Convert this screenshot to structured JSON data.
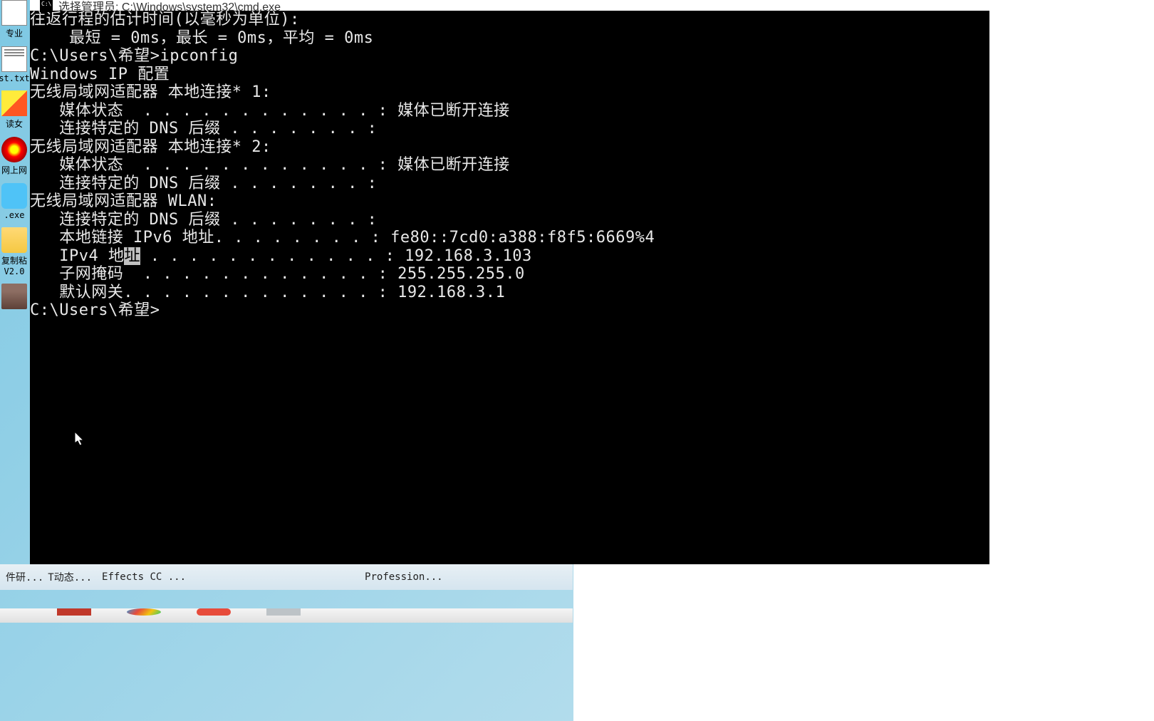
{
  "window": {
    "title": "选择管理员: C:\\Windows\\system32\\cmd.exe"
  },
  "desktop_icons": [
    {
      "label": "专业"
    },
    {
      "label": "st.txt"
    },
    {
      "label": "读女"
    },
    {
      "label": "网上网"
    },
    {
      "label": ".exe"
    },
    {
      "label": "复制粘"
    },
    {
      "label": "V2.0"
    },
    {
      "label": ""
    }
  ],
  "terminal": {
    "line1": "往返行程的估计时间(以毫秒为单位):",
    "line2": "    最短 = 0ms，最长 = 0ms，平均 = 0ms",
    "line3": "",
    "prompt1": "C:\\Users\\希望>",
    "cmd1": "ipconfig",
    "line5": "",
    "line6": "Windows IP 配置",
    "line7": "",
    "line8": "",
    "adapter1_title": "无线局域网适配器 本地连接* 1:",
    "line10": "",
    "adapter1_media": "   媒体状态  . . . . . . . . . . . . : 媒体已断开连接",
    "adapter1_dns": "   连接特定的 DNS 后缀 . . . . . . . :",
    "line13": "",
    "adapter2_title": "无线局域网适配器 本地连接* 2:",
    "line15": "",
    "adapter2_media": "   媒体状态  . . . . . . . . . . . . : 媒体已断开连接",
    "adapter2_dns": "   连接特定的 DNS 后缀 . . . . . . . :",
    "line18": "",
    "adapter3_title": "无线局域网适配器 WLAN:",
    "line20": "",
    "adapter3_dns": "   连接特定的 DNS 后缀 . . . . . . . :",
    "adapter3_ipv6": "   本地链接 IPv6 地址. . . . . . . . : fe80::7cd0:a388:f8f5:6669%4",
    "adapter3_ipv4_label": "   IPv4 地",
    "adapter3_ipv4_hl": "址",
    "adapter3_ipv4_rest": " . . . . . . . . . . . . : 192.168.3.103",
    "adapter3_mask": "   子网掩码  . . . . . . . . . . . . : 255.255.255.0",
    "adapter3_gateway": "   默认网关. . . . . . . . . . . . . : 192.168.3.1",
    "line26": "",
    "prompt2": "C:\\Users\\希望>"
  },
  "taskbar": {
    "item1": "件研...",
    "item2": "T动态...",
    "item3": "Effects CC ...",
    "item4": "Profession..."
  }
}
